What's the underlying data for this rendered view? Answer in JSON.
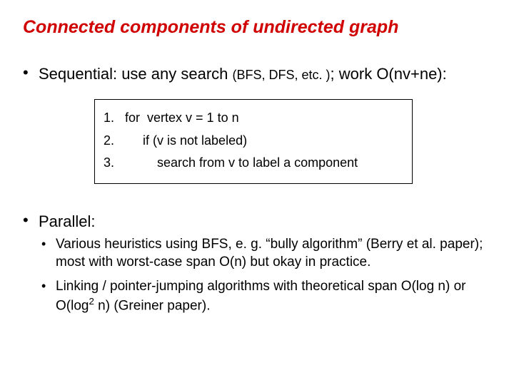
{
  "title": "Connected components of undirected graph",
  "bullet1": {
    "lead": "Sequential:  use any search ",
    "paren": "(BFS, DFS, etc. )",
    "tail": "; work O(nv+ne):"
  },
  "code": {
    "line1": "1.   for  vertex v = 1 to n",
    "line2": "2.        if (v is not labeled)",
    "line3": "3.            search from v to label a component"
  },
  "bullet2": "Parallel:",
  "sub1": "Various heuristics using BFS, e. g. “bully algorithm” (Berry et al. paper); most with worst-case span O(n) but okay in practice.",
  "sub2_a": "Linking / pointer-jumping algorithms with theoretical span O(log n) or O(log",
  "sub2_sup": "2",
  "sub2_b": " n)   (Greiner paper)."
}
